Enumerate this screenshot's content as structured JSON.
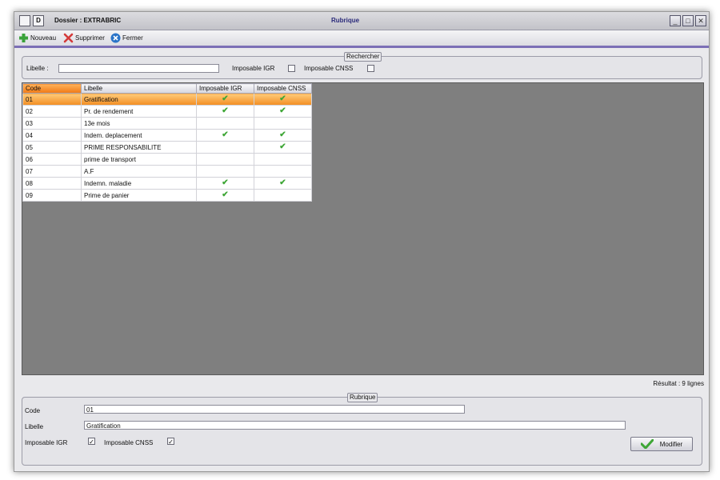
{
  "titlebar": {
    "icon1_label": "",
    "icon2_label": "D",
    "dossier": "Dossier : EXTRABRIC",
    "title": "Rubrique",
    "minimize": "_",
    "maximize": "□",
    "close": "✕"
  },
  "toolbar": {
    "nouveau": "Nouveau",
    "supprimer": "Supprimer",
    "fermer": "Fermer"
  },
  "search": {
    "legend": "Rechercher",
    "libelle_label": "Libelle :",
    "libelle_value": "",
    "igr_label": "Imposable IGR",
    "cnss_label": "Imposable CNSS"
  },
  "grid": {
    "columns": [
      "Code",
      "Libelle",
      "Imposable IGR",
      "Imposable CNSS"
    ],
    "rows": [
      {
        "code": "01",
        "libelle": "Gratification",
        "igr": true,
        "cnss": true
      },
      {
        "code": "02",
        "libelle": "Pr. de rendement",
        "igr": true,
        "cnss": true
      },
      {
        "code": "03",
        "libelle": "13e mois",
        "igr": false,
        "cnss": false
      },
      {
        "code": "04",
        "libelle": "Indem. deplacement",
        "igr": true,
        "cnss": true
      },
      {
        "code": "05",
        "libelle": "PRIME RESPONSABILITE",
        "igr": false,
        "cnss": true
      },
      {
        "code": "06",
        "libelle": "prime de transport",
        "igr": false,
        "cnss": false
      },
      {
        "code": "07",
        "libelle": "A.F",
        "igr": false,
        "cnss": false
      },
      {
        "code": "08",
        "libelle": "Indemn. maladie",
        "igr": true,
        "cnss": true
      },
      {
        "code": "09",
        "libelle": "Prime de panier",
        "igr": true,
        "cnss": false
      }
    ],
    "selected_index": 0,
    "check_glyph": "✔"
  },
  "result": "Résultat : 9 lignes",
  "detail": {
    "legend": "Rubrique",
    "code_label": "Code",
    "code_value": "01",
    "libelle_label": "Libelle",
    "libelle_value": "Gratification",
    "igr_label": "Imposable IGR",
    "cnss_label": "Imposable CNSS",
    "igr_checked": "✓",
    "cnss_checked": "✓",
    "modifier": "Modifier"
  },
  "colors": {
    "accent": "#7c6fb6",
    "selection": "#f28d22",
    "check": "#3ea636"
  },
  "icons": {
    "nouveau": "plus-icon",
    "supprimer": "delete-icon",
    "fermer": "close-circle-icon",
    "modifier": "check-icon"
  }
}
